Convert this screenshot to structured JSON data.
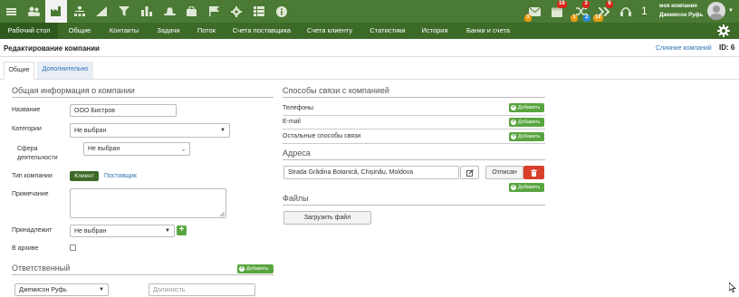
{
  "topbar": {
    "icons": [
      "menu-icon",
      "users-icon",
      "factory-icon",
      "org-chart-icon",
      "chart-icon",
      "filter-icon",
      "hat-icon",
      "bag-icon",
      "flag-icon",
      "gear-icon",
      "list-icon",
      "info-icon"
    ],
    "notifications": [
      {
        "icon": "mail-icon",
        "badge": "1",
        "badge_color": "#e89a12"
      },
      {
        "icon": "calendar-icon",
        "top_badge": "19",
        "badge": "1"
      },
      {
        "icon": "shuffle-icon",
        "top_badge": "3",
        "badge": "2",
        "badge2": "12"
      },
      {
        "icon": "forward-icon",
        "top_badge": "8"
      },
      {
        "icon": "headset-icon"
      }
    ],
    "count": "1",
    "company_name": "моя компания",
    "user_name": "Джемисон Руфь"
  },
  "navbar": {
    "items": [
      "Рабочий стол",
      "Общие",
      "Контакты",
      "Задачи",
      "Поток",
      "Счета поставщика",
      "Счета клиенту",
      "Статистики",
      "История",
      "Банки и счета"
    ]
  },
  "header": {
    "title": "Редактирование компании",
    "merge_link": "Слияние компаний",
    "id_label": "ID: 6"
  },
  "tabs": [
    "Общие",
    "Дополнительно"
  ],
  "general": {
    "section_title": "Общая информация о компании",
    "name_label": "Название",
    "name_value": "ООО Бистров",
    "category_label": "Категории",
    "category_value": "Не выбран",
    "sphere_label_1": "Сфера",
    "sphere_label_2": "деятельности",
    "sphere_value": "Не выбран",
    "type_label": "Тип компании",
    "type_client": "Клиент",
    "type_supplier": "Поставщик",
    "note_label": "Примечание",
    "belongs_label": "Принадлежит",
    "belongs_value": "Не выбран",
    "archive_label": "В архиве"
  },
  "responsible": {
    "section_title": "Ответственный",
    "add_label": "Добавить",
    "person_value": "Джемисон Руфь",
    "position_placeholder": "Должность"
  },
  "contacts": {
    "section_title": "Способы связи с компанией",
    "rows": [
      {
        "label": "Телефоны",
        "add": "Добавить"
      },
      {
        "label": "E-mail",
        "add": "Добавить"
      },
      {
        "label": "Остальные способы связи",
        "add": "Добавить"
      }
    ]
  },
  "address": {
    "section_title": "Адреса",
    "value": "Strada Grădina Botanică, Chișinău, Moldova",
    "unsubscribe_label": "Отписан",
    "add_label": "Добавить"
  },
  "files": {
    "section_title": "Файлы",
    "upload_label": "Загрузить файл"
  }
}
